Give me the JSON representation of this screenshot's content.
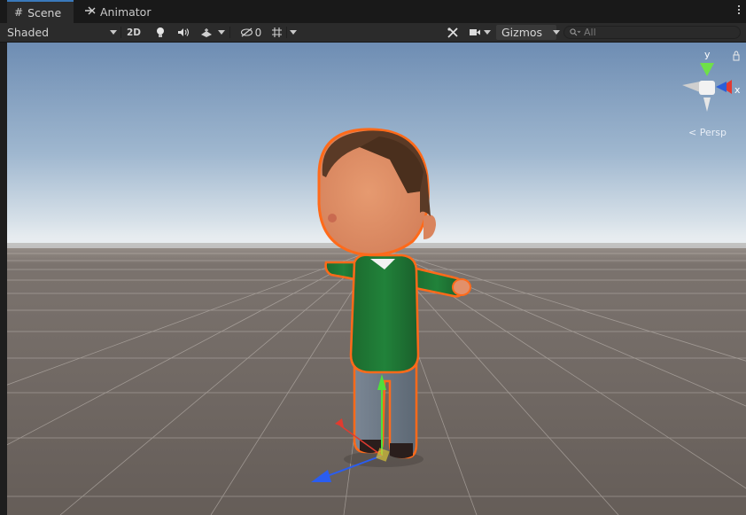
{
  "tabs": [
    {
      "icon": "grid-icon",
      "label": "Scene"
    },
    {
      "icon": "animator-icon",
      "label": "Animator"
    }
  ],
  "toolbar": {
    "shading_mode": "Shaded",
    "toggle_2d": "2D",
    "hidden_count": "0",
    "gizmos_label": "Gizmos",
    "search_placeholder": "All"
  },
  "viewport": {
    "persp_label": "Persp",
    "axis_y": "y",
    "axis_x": "x",
    "sky_top": "#6e8db3",
    "horizon": "#dfe6ec",
    "ground": "#6d6560"
  }
}
